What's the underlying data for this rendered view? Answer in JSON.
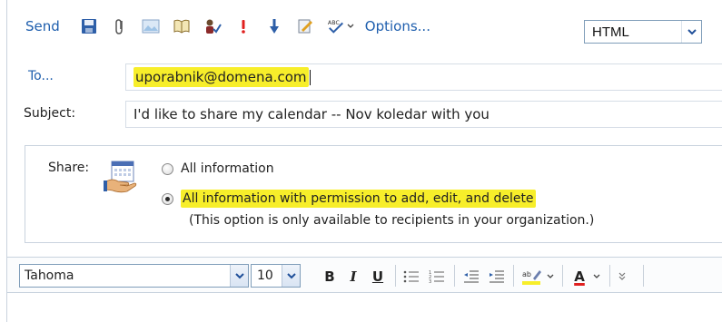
{
  "toolbar": {
    "send_label": "Send",
    "options_label": "Options...",
    "format_value": "HTML"
  },
  "fields": {
    "to_label": "To...",
    "to_value": "uporabnik@domena.com",
    "subject_label": "Subject:",
    "subject_value": "I'd like to share my calendar -- Nov koledar with you"
  },
  "share": {
    "label": "Share:",
    "options": [
      {
        "label": "All information",
        "selected": false
      },
      {
        "label": "All information with permission to add, edit, and delete",
        "selected": true
      }
    ],
    "note": "(This option is only available to recipients in your organization.)"
  },
  "format_bar": {
    "font_value": "Tahoma",
    "size_value": "10",
    "bold": "B",
    "italic": "I",
    "underline": "U",
    "font_color_letter": "A"
  },
  "colors": {
    "link_blue": "#1f5fae",
    "highlight_yellow": "#f7ee2a",
    "font_color_red": "#e02020"
  }
}
